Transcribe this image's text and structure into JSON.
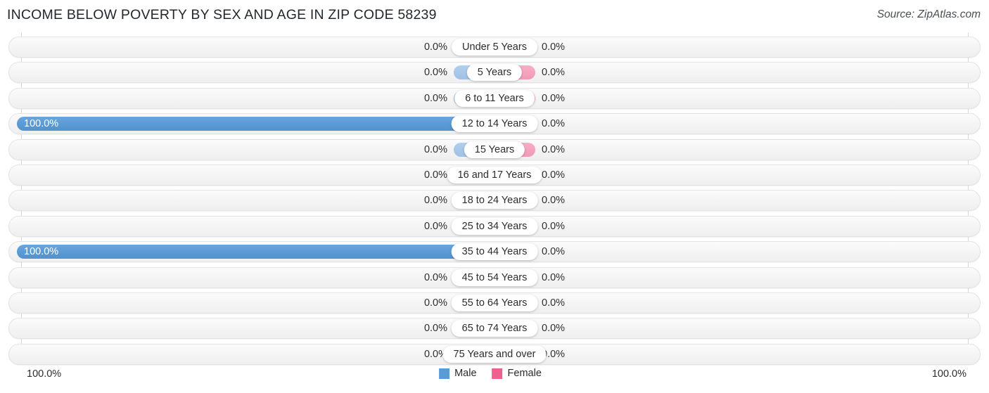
{
  "header": {
    "title": "INCOME BELOW POVERTY BY SEX AND AGE IN ZIP CODE 58239",
    "source": "Source: ZipAtlas.com"
  },
  "axis": {
    "left_end_label": "100.0%",
    "right_end_label": "100.0%"
  },
  "legend": {
    "items": [
      {
        "label": "Male",
        "color": "#5b9bd5"
      },
      {
        "label": "Female",
        "color": "#ef5f90"
      }
    ]
  },
  "colors": {
    "male_zero": "#a8c8e9",
    "male_full": "#5b9bd5",
    "female_zero": "#f5a3bd",
    "female_full": "#ec5f93",
    "track": "#f4f4f4",
    "gridline": "#d9d9d9"
  },
  "chart_data": {
    "type": "bar",
    "title": "INCOME BELOW POVERTY BY SEX AND AGE IN ZIP CODE 58239",
    "subtitle": "",
    "xlabel": "",
    "ylabel": "",
    "orientation": "horizontal-diverging",
    "xlim": [
      0,
      100
    ],
    "grid": false,
    "legend_position": "bottom-center",
    "categories": [
      "Under 5 Years",
      "5 Years",
      "6 to 11 Years",
      "12 to 14 Years",
      "15 Years",
      "16 and 17 Years",
      "18 to 24 Years",
      "25 to 34 Years",
      "35 to 44 Years",
      "45 to 54 Years",
      "55 to 64 Years",
      "65 to 74 Years",
      "75 Years and over"
    ],
    "series": [
      {
        "name": "Male",
        "values": [
          0.0,
          0.0,
          0.0,
          100.0,
          0.0,
          0.0,
          0.0,
          0.0,
          100.0,
          0.0,
          0.0,
          0.0,
          0.0
        ],
        "labels": [
          "0.0%",
          "0.0%",
          "0.0%",
          "100.0%",
          "0.0%",
          "0.0%",
          "0.0%",
          "0.0%",
          "100.0%",
          "0.0%",
          "0.0%",
          "0.0%",
          "0.0%"
        ]
      },
      {
        "name": "Female",
        "values": [
          0.0,
          0.0,
          0.0,
          0.0,
          0.0,
          0.0,
          0.0,
          0.0,
          0.0,
          0.0,
          0.0,
          0.0,
          0.0
        ],
        "labels": [
          "0.0%",
          "0.0%",
          "0.0%",
          "0.0%",
          "0.0%",
          "0.0%",
          "0.0%",
          "0.0%",
          "0.0%",
          "0.0%",
          "0.0%",
          "0.0%",
          "0.0%"
        ]
      }
    ]
  }
}
